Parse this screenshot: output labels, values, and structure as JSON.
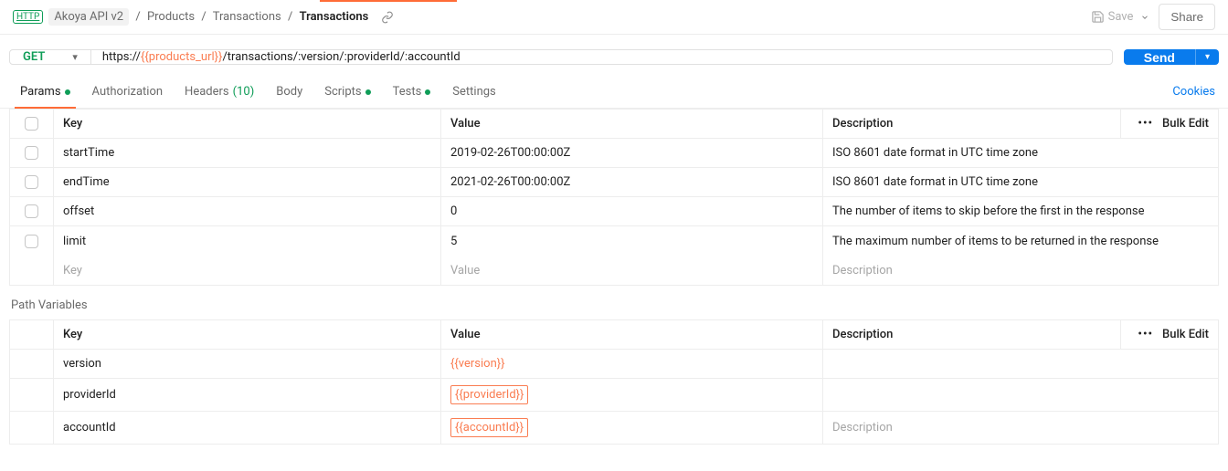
{
  "breadcrumb": {
    "collection": "Akoya API v2",
    "folder1": "Products",
    "folder2": "Transactions",
    "current": "Transactions"
  },
  "toolbar": {
    "save": "Save",
    "share": "Share"
  },
  "request": {
    "method": "GET",
    "url_prefix": "https://",
    "url_var": "{{products_url}}",
    "url_suffix": "/transactions/:version/:providerId/:accountId",
    "send": "Send"
  },
  "tabs": {
    "params": "Params",
    "authorization": "Authorization",
    "headers": "Headers",
    "headers_count": "(10)",
    "body": "Body",
    "scripts": "Scripts",
    "tests": "Tests",
    "settings": "Settings",
    "cookies": "Cookies"
  },
  "params_table": {
    "header_key": "Key",
    "header_value": "Value",
    "header_desc": "Description",
    "bulk_edit": "Bulk Edit",
    "rows": [
      {
        "key": "startTime",
        "value": "2019-02-26T00:00:00Z",
        "desc": "ISO 8601 date format in UTC time zone"
      },
      {
        "key": "endTime",
        "value": "2021-02-26T00:00:00Z",
        "desc": "ISO 8601 date format in UTC time zone"
      },
      {
        "key": "offset",
        "value": "0",
        "desc": "The number of items to skip before the first in the response"
      },
      {
        "key": "limit",
        "value": "5",
        "desc": "The maximum number of items to be returned in the response"
      }
    ],
    "placeholder_key": "Key",
    "placeholder_value": "Value",
    "placeholder_desc": "Description"
  },
  "path_vars": {
    "title": "Path Variables",
    "header_key": "Key",
    "header_value": "Value",
    "header_desc": "Description",
    "bulk_edit": "Bulk Edit",
    "rows": [
      {
        "key": "version",
        "value": "{{version}}",
        "desc": "",
        "boxed": false
      },
      {
        "key": "providerId",
        "value": "{{providerId}}",
        "desc": "",
        "boxed": true
      },
      {
        "key": "accountId",
        "value": "{{accountId}}",
        "desc": "Description",
        "boxed": true,
        "desc_placeholder": true
      }
    ]
  }
}
